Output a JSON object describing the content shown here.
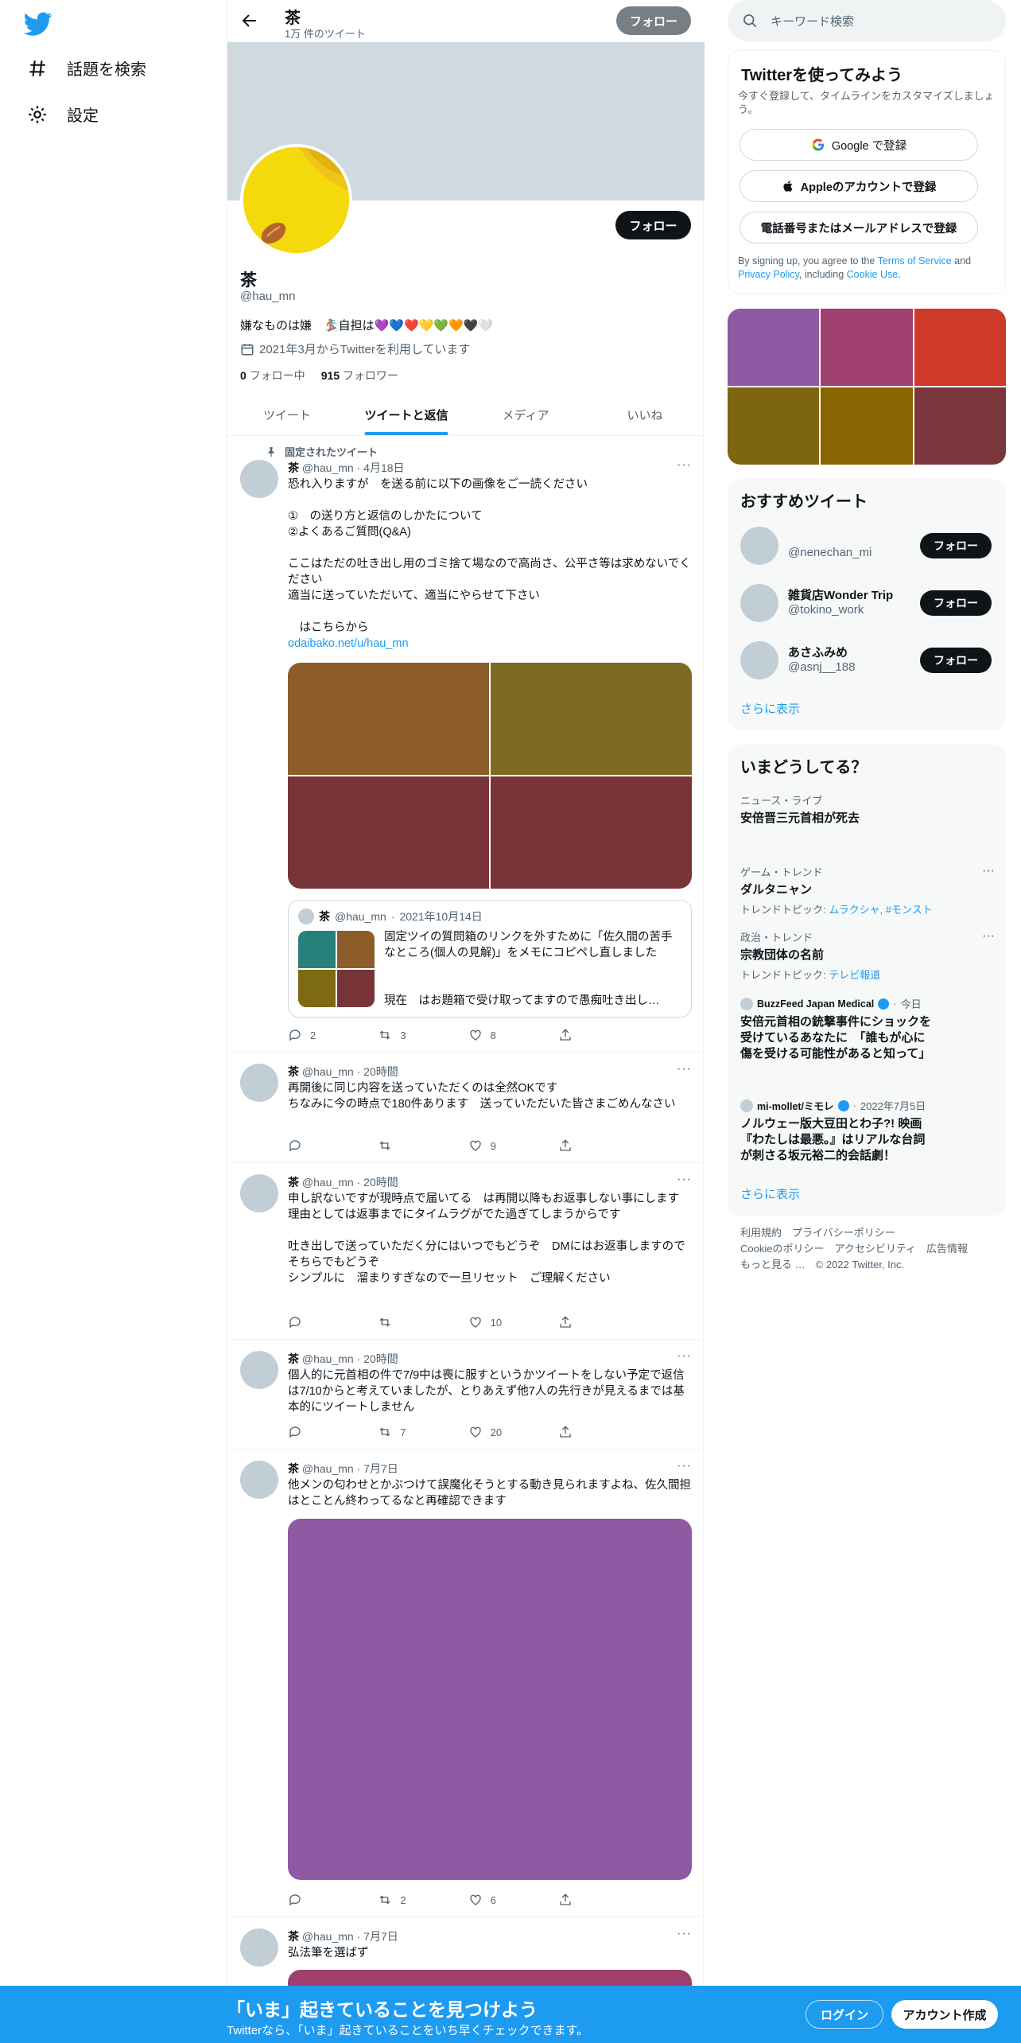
{
  "nav": {
    "explore_label": "話題を検索",
    "settings_label": "設定"
  },
  "header": {
    "name": "茶",
    "tweet_count": "1万 件のツイート",
    "follow_label": "フォロー"
  },
  "profile": {
    "name": "茶",
    "handle": "@hau_mn",
    "bio": "嫌なものは嫌　🏂自担は💜💙❤️💛💚🧡🖤🤍",
    "joined": "2021年3月からTwitterを利用しています",
    "following_count": "0",
    "following_label": "フォロー中",
    "followers_count": "915",
    "followers_label": "フォロワー",
    "follow_label": "フォロー"
  },
  "tabs": [
    "ツイート",
    "ツイートと返信",
    "メディア",
    "いいね"
  ],
  "pinned_label": "固定されたツイート",
  "tweets": [
    {
      "name": "茶",
      "handle": "@hau_mn",
      "time": "4月18日",
      "text": "恐れ入りますが　を送る前に以下の画像をご一読ください\n\n①　の送り方と返信のしかたについて\n②よくあるご質問(Q&A)\n\nここはただの吐き出し用のゴミ捨て場なので高尚さ、公平さ等は求めないでください\n適当に送っていただいて、適当にやらせて下さい\n\n　はこちらから",
      "link": "odaibako.net/u/hau_mn",
      "replies": "2",
      "retweets": "3",
      "likes": "8"
    },
    {
      "name": "茶",
      "handle": "@hau_mn",
      "time": "20時間",
      "text": "再開後に同じ内容を送っていただくのは全然OKです\nちなみに今の時点で180件あります　送っていただいた皆さまごめんなさい",
      "replies": "",
      "retweets": "",
      "likes": "9"
    },
    {
      "name": "茶",
      "handle": "@hau_mn",
      "time": "20時間",
      "text": "申し訳ないですが現時点で届いてる　は再開以降もお返事しない事にします\n理由としては返事までにタイムラグがでた過ぎてしまうからです\n\n吐き出しで送っていただく分にはいつでもどうぞ　DMにはお返事しますのでそちらでもどうぞ\nシンプルに　溜まりすぎなので一旦リセット　ご理解ください",
      "replies": "",
      "retweets": "",
      "likes": "10"
    },
    {
      "name": "茶",
      "handle": "@hau_mn",
      "time": "20時間",
      "text": "個人的に元首相の件で7/9中は喪に服すというかツイートをしない予定で返信は7/10からと考えていましたが、とりあえず他7人の先行きが見えるまでは基本的にツイートしません",
      "replies": "",
      "retweets": "7",
      "likes": "20"
    },
    {
      "name": "茶",
      "handle": "@hau_mn",
      "time": "7月7日",
      "text": "他メンの匂わせとかぶつけて誤魔化そうとする動き見られますよね、佐久間担はとことん終わってるなと再確認できます",
      "replies": "",
      "retweets": "2",
      "likes": "6"
    },
    {
      "name": "茶",
      "handle": "@hau_mn",
      "time": "7月7日",
      "text": "弘法筆を選ばず"
    }
  ],
  "quote": {
    "name": "茶",
    "handle": "@hau_mn",
    "time": "2021年10月14日",
    "text": "固定ツイの質問箱のリンクを外すために「佐久間の苦手なところ(個人の見解)」をメモにコピペし直しました",
    "text2": "現在　はお題箱で受け取ってますので愚痴吐き出し…"
  },
  "search": {
    "placeholder": "キーワード検索"
  },
  "signup": {
    "title": "Twitterを使ってみよう",
    "subtitle": "今すぐ登録して、タイムラインをカスタマイズしましょう。",
    "google_label": "Google で登録",
    "apple_label": "Appleのアカウントで登録",
    "phone_label": "電話番号またはメールアドレスで登録",
    "terms_pre": "By signing up, you agree to the ",
    "terms_link": "Terms of Service",
    "terms_and": " and ",
    "privacy_link": "Privacy Policy",
    "terms_mid": ", including ",
    "cookie_link": "Cookie Use",
    "terms_end": "."
  },
  "who_to_follow": {
    "title": "おすすめツイート",
    "users": [
      {
        "name": "",
        "handle": "@nenechan_mi"
      },
      {
        "name": "雑貨店Wonder Trip",
        "handle": "@tokino_work"
      },
      {
        "name": "あさふみめ",
        "handle": "@asnj__188"
      }
    ],
    "follow_label": "フォロー",
    "show_more": "さらに表示"
  },
  "trends": {
    "title": "いまどうしてる？",
    "items": [
      {
        "category": "ニュース・ライブ",
        "title": "安倍晋三元首相が死去"
      },
      {
        "category": "ゲーム・トレンド",
        "title": "ダルタニャン",
        "sub_pre": "トレンドトピック: ",
        "sub_links": "ムラクシャ, #モンスト"
      },
      {
        "category": "政治・トレンド",
        "title": "宗教団体の名前",
        "sub_pre": "トレンドトピック: ",
        "sub_links": "テレビ報道"
      },
      {
        "source": "BuzzFeed Japan Medical",
        "time": "今日",
        "title": "安倍元首相の銃撃事件にショックを受けているあなたに　「誰もが心に傷を受ける可能性があると知って」"
      },
      {
        "source": "mi-mollet/ミモレ",
        "time": "2022年7月5日",
        "title": "ノルウェー版大豆田とわ子?! 映画『わたしは最悪。』はリアルな台詞が刺さる坂元裕二的会話劇！"
      }
    ],
    "show_more": "さらに表示"
  },
  "footer": {
    "links_line1": "利用規約　プライバシーポリシー",
    "links_line2": "Cookieのポリシー　アクセシビリティ　広告情報",
    "more": "もっと見る …",
    "copyright": "© 2022 Twitter, Inc."
  },
  "bottom_bar": {
    "title": "「いま」起きていることを見つけよう",
    "subtitle": "Twitterなら、「いま」起きていることをいち早くチェックできます。",
    "login_label": "ログイン",
    "signup_label": "アカウント作成"
  },
  "colors": {
    "accent": "#1d9bf0",
    "text": "#0f1419",
    "muted": "#536471",
    "banner": "#cfd9de"
  }
}
